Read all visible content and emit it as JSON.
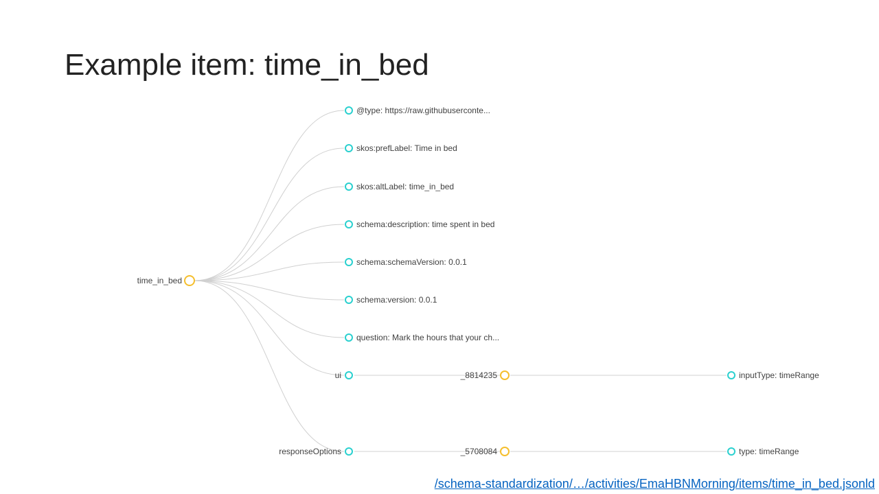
{
  "title": "Example item: time_in_bed",
  "footer": "/schema-standardization/…/activities/EmaHBNMorning/items/time_in_bed.jsonld",
  "root": {
    "label": "time_in_bed"
  },
  "branches": [
    {
      "label": "@type: https://raw.githubuserconte..."
    },
    {
      "label": "skos:prefLabel: Time in bed"
    },
    {
      "label": "skos:altLabel: time_in_bed"
    },
    {
      "label": "schema:description: time spent in bed"
    },
    {
      "label": "schema:schemaVersion: 0.0.1"
    },
    {
      "label": "schema:version: 0.0.1"
    },
    {
      "label": "question: Mark the hours that your ch..."
    },
    {
      "label": "ui",
      "mid": "_8814235",
      "leaf": "inputType: timeRange"
    },
    {
      "label": "responseOptions",
      "mid": "_5708084",
      "leaf": "type: timeRange"
    }
  ]
}
